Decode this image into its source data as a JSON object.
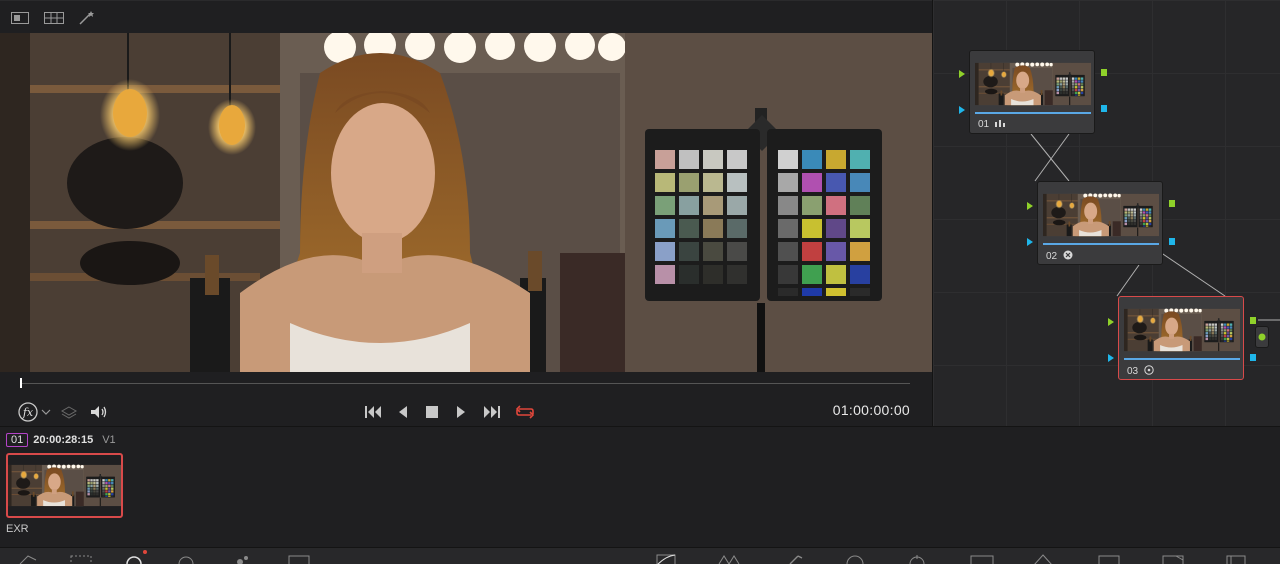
{
  "viewer": {
    "timecode": "01:00:00:00"
  },
  "transport": {
    "fx_label": "fx",
    "loop_color": "#e0473b"
  },
  "nodes": [
    {
      "number": "01",
      "icon": "levels-icon"
    },
    {
      "number": "02",
      "icon": "circle-cross-icon"
    },
    {
      "number": "03",
      "icon": "target-icon",
      "selected": true
    }
  ],
  "clip": {
    "index": "01",
    "timecode": "20:00:28:15",
    "track": "V1",
    "codec": "EXR"
  },
  "colors": {
    "accent_red": "#d84a4a",
    "port_green": "#8fd12a",
    "port_blue": "#1fb6ea",
    "clip_index_border": "#b344c8"
  }
}
